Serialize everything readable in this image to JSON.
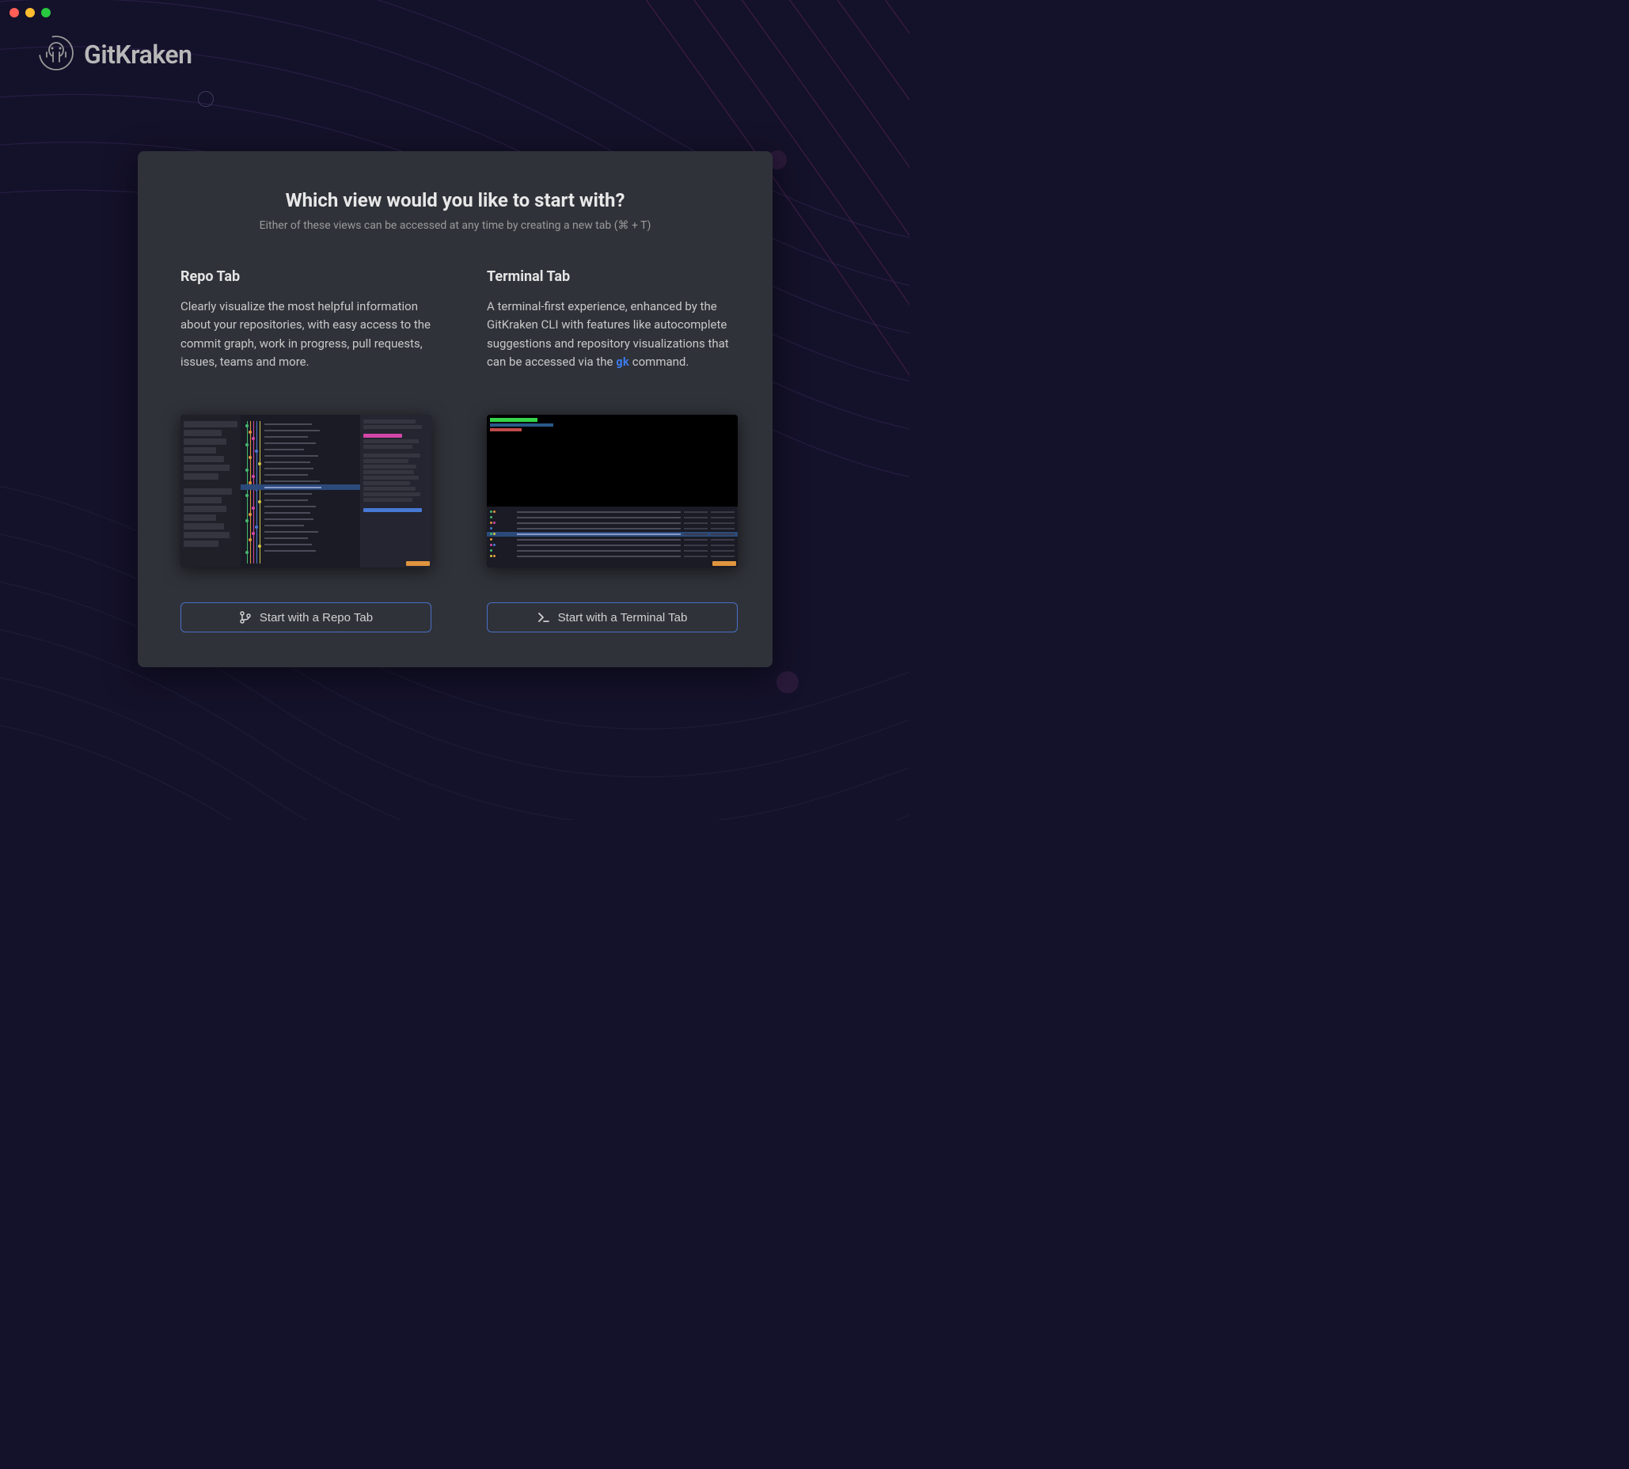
{
  "logo": {
    "text": "GitKraken"
  },
  "card": {
    "title": "Which view would you like to start with?",
    "subtitle": "Either of these views can be accessed at any time by creating a new tab (⌘ + T)"
  },
  "repo": {
    "title": "Repo Tab",
    "description": "Clearly visualize the most helpful information about your repositories, with easy access to the commit graph, work in progress, pull requests, issues, teams and more.",
    "button_label": "Start with a Repo Tab"
  },
  "terminal": {
    "title": "Terminal Tab",
    "description_pre": "A terminal-first experience, enhanced by the GitKraken CLI with features like autocomplete suggestions and repository visualizations that can be accessed via the ",
    "command": "gk",
    "description_post": " command.",
    "button_label": "Start with a Terminal Tab"
  }
}
